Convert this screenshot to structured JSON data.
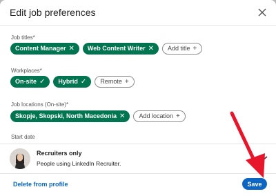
{
  "modal": {
    "title": "Edit job preferences",
    "close_icon": "close-icon"
  },
  "job_titles": {
    "label": "Job titles*",
    "selected": [
      "Content Manager",
      "Web Content Writer"
    ],
    "add_label": "Add title"
  },
  "workplaces": {
    "label": "Workplaces*",
    "selected": [
      "On-site",
      "Hybrid"
    ],
    "unselected": [
      "Remote"
    ]
  },
  "job_locations": {
    "label": "Job locations (On-site)*",
    "selected": [
      "Skopje, Skopski, North Macedonia"
    ],
    "add_label": "Add location"
  },
  "start_date": {
    "label": "Start date"
  },
  "audience": {
    "title": "Recruiters only",
    "description": "People using LinkedIn Recruiter."
  },
  "footer": {
    "delete_label": "Delete from profile",
    "save_label": "Save"
  },
  "colors": {
    "chip_green": "#01754f",
    "primary_blue": "#0a66c2",
    "annotation_red": "#e8162a"
  }
}
